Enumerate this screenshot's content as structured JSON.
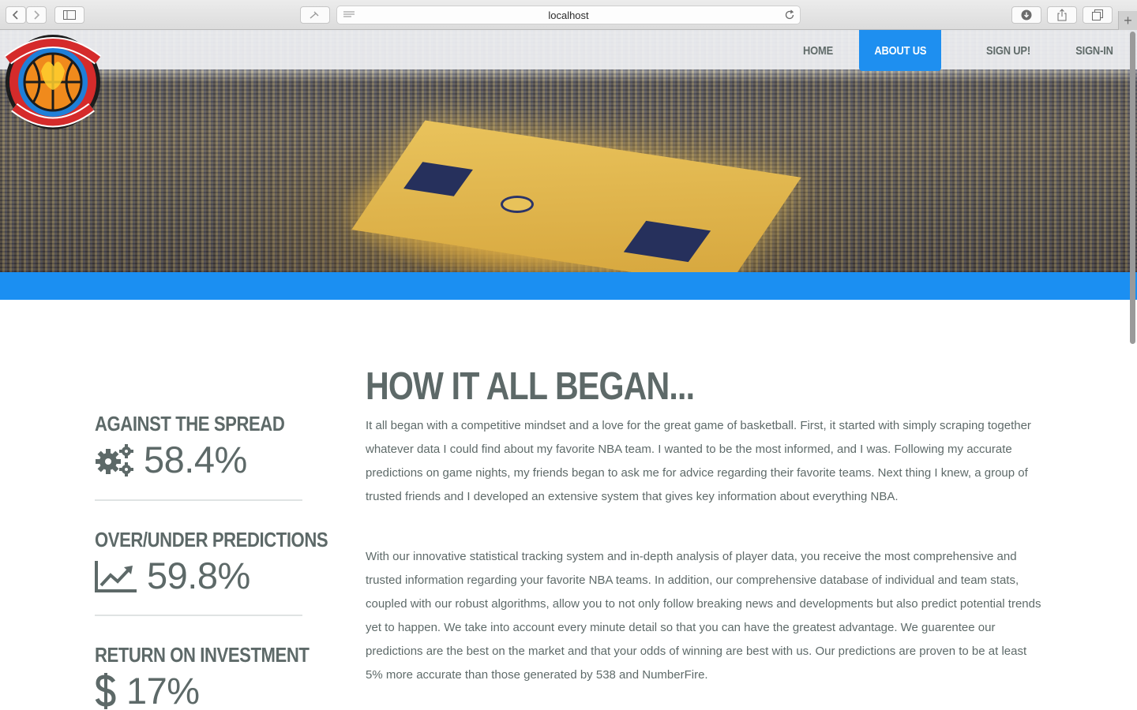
{
  "browser": {
    "url": "localhost",
    "new_tab_label": "+"
  },
  "nav": {
    "items": [
      {
        "label": "HOME",
        "active": false
      },
      {
        "label": "ABOUT US",
        "active": true
      },
      {
        "label": "SIGN UP!",
        "active": false
      },
      {
        "label": "SIGN-IN",
        "active": false
      }
    ]
  },
  "logo": {
    "top_text": "HEAT CHECK",
    "bottom_text": "HOT · FIRE · PICKS"
  },
  "stats": [
    {
      "title": "AGAINST THE SPREAD",
      "icon": "gears-icon",
      "value": "58.4%"
    },
    {
      "title": "OVER/UNDER PREDICTIONS",
      "icon": "line-chart-icon",
      "value": "59.8%"
    },
    {
      "title": "RETURN ON INVESTMENT",
      "icon": "dollar-icon",
      "value": "17%"
    }
  ],
  "about": {
    "heading": "HOW IT ALL BEGAN...",
    "paragraphs": [
      "It all began with a competitive mindset and a love for the great game of basketball. First, it started with simply scraping together whatever data I could find about my favorite NBA team. I wanted to be the most informed, and I was. Following my accurate predictions on game nights, my friends began to ask me for advice regarding their favorite teams. Next thing I knew, a group of trusted friends and I developed an extensive system that gives key information about everything NBA.",
      "With our innovative statistical tracking system and in-depth analysis of player data, you receive the most comprehensive and trusted information regarding your favorite NBA teams. In addition, our comprehensive database of individual and team stats, coupled with our robust algorithms, allow you to not only follow breaking news and developments but also predict potential trends yet to happen. We take into account every minute detail so that you can have the greatest advantage. We guarentee our predictions are the best on the market and that your odds of winning are best with us. Our predictions are proven to be at least 5% more accurate than those generated by 538 and NumberFire."
    ]
  },
  "colors": {
    "accent": "#1b8ff2",
    "text": "#5d6968"
  }
}
